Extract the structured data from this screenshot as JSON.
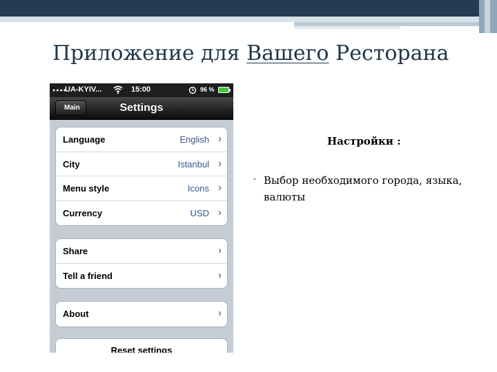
{
  "slide": {
    "title_part1": "Приложение для ",
    "title_part2": "Вашего",
    "title_part3": " Ресторана"
  },
  "phone": {
    "status_bar": {
      "carrier": "UA-KYIV...",
      "time": "15:00",
      "battery_percent": "96 %",
      "signal_icon": "signal-dots-icon",
      "wifi_icon": "wifi-icon",
      "alarm_icon": "alarm-clock-icon",
      "battery_icon": "battery-icon",
      "battery_color": "#45c63b"
    },
    "nav": {
      "back_label": "Main",
      "title": "Settings"
    },
    "groups": [
      {
        "rows": [
          {
            "label": "Language",
            "value": "English"
          },
          {
            "label": "City",
            "value": "Istanbul"
          },
          {
            "label": "Menu style",
            "value": "Icons"
          },
          {
            "label": "Currency",
            "value": "USD"
          }
        ]
      },
      {
        "rows": [
          {
            "label": "Share"
          },
          {
            "label": "Tell a friend"
          }
        ]
      },
      {
        "rows": [
          {
            "label": "About"
          }
        ]
      },
      {
        "rows": [
          {
            "label": "Reset settings"
          }
        ]
      }
    ],
    "chevron_icon": "chevron-right-icon"
  },
  "content": {
    "heading": "Настройки :",
    "bullets": [
      "Выбор необходимого города, языка, валюты"
    ]
  },
  "colors": {
    "title": "#1f3549",
    "top_band": "#243b53",
    "bullet": "#7f9fba",
    "value_text": "#385487",
    "phone_background": "#c5ccd6"
  }
}
